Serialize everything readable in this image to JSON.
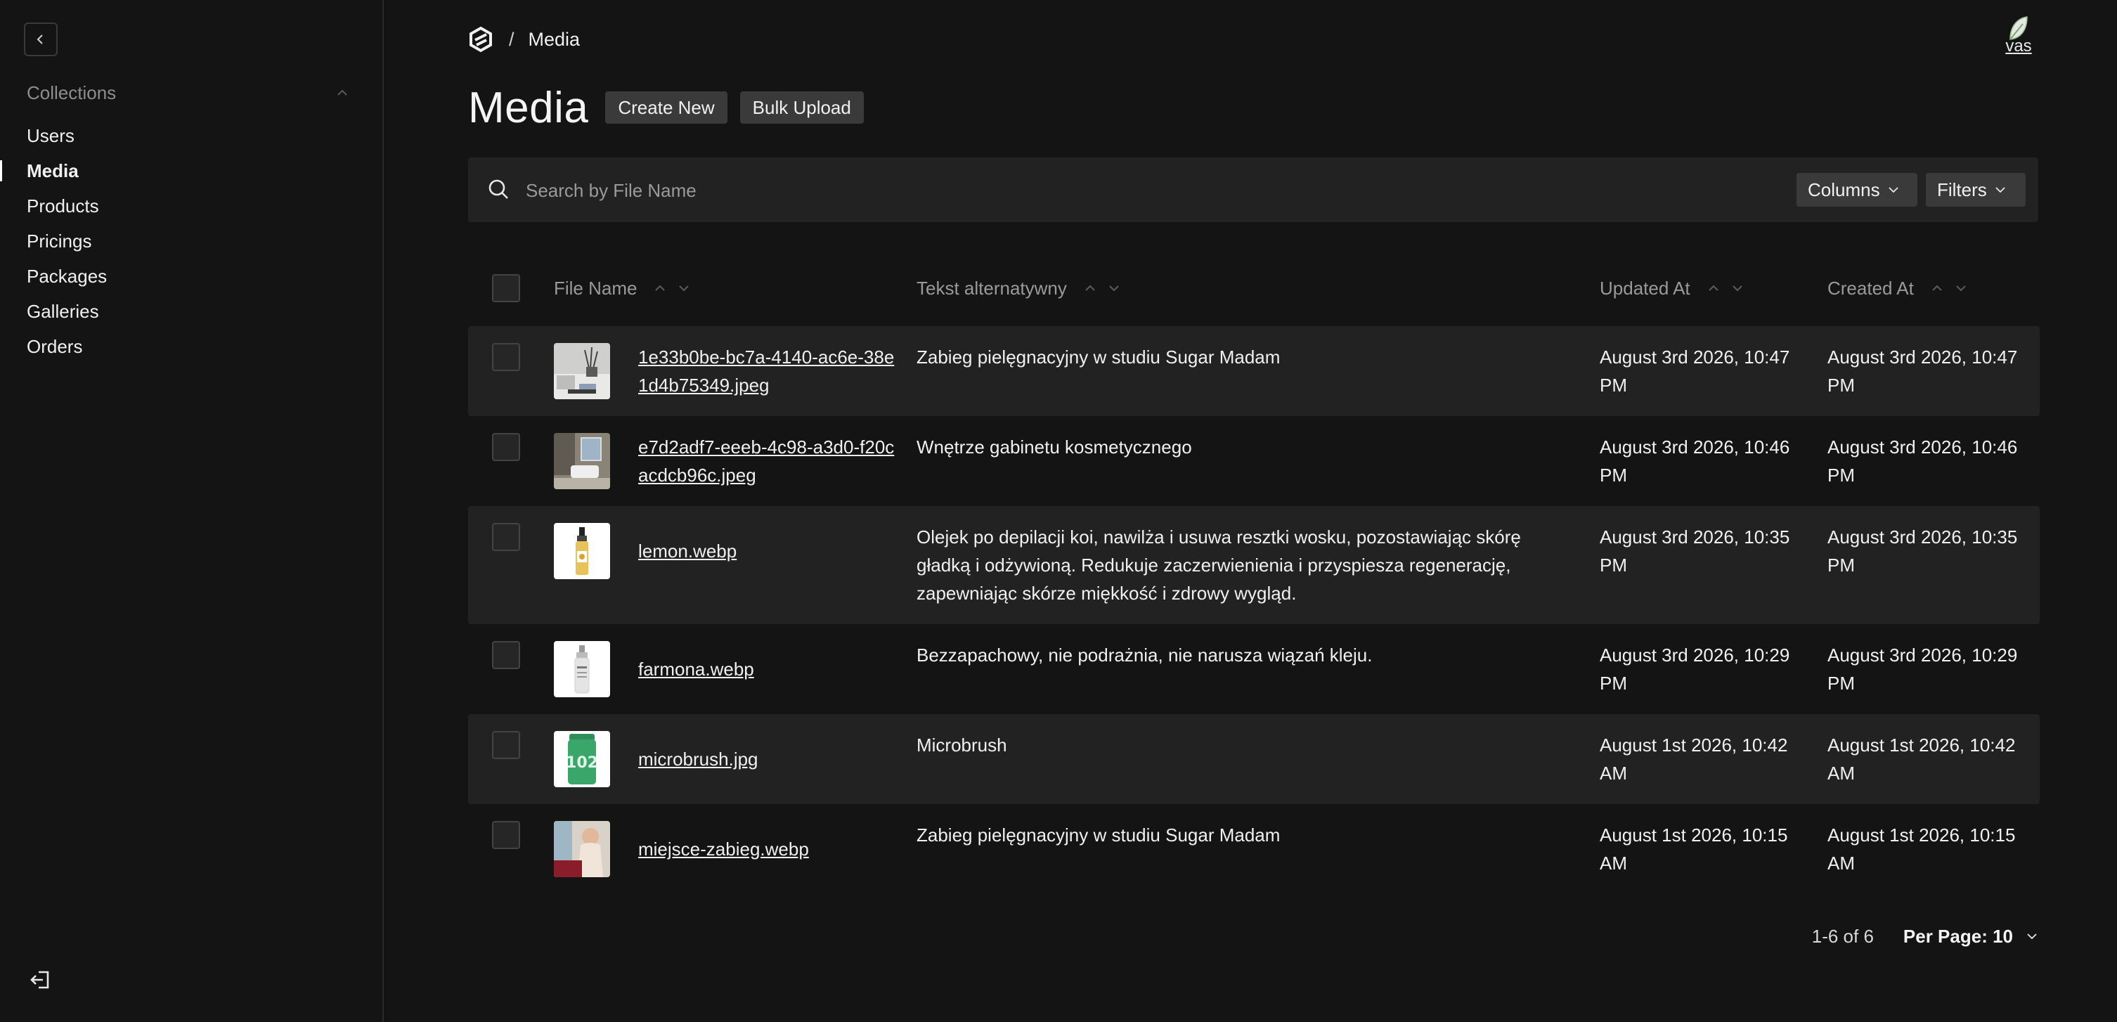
{
  "sidebar": {
    "collections_label": "Collections",
    "items": [
      {
        "label": "Users"
      },
      {
        "label": "Media"
      },
      {
        "label": "Products"
      },
      {
        "label": "Pricings"
      },
      {
        "label": "Packages"
      },
      {
        "label": "Galleries"
      },
      {
        "label": "Orders"
      }
    ],
    "active_item": "Media"
  },
  "header": {
    "breadcrumb_separator": "/",
    "breadcrumb_current": "Media",
    "avatar_alt": "vas",
    "title": "Media",
    "create_new_label": "Create New",
    "bulk_upload_label": "Bulk Upload"
  },
  "search": {
    "placeholder": "Search by File Name",
    "columns_label": "Columns",
    "filters_label": "Filters"
  },
  "table": {
    "columns": {
      "file_name": "File Name",
      "alt_text": "Tekst alternatywny",
      "updated_at": "Updated At",
      "created_at": "Created At"
    },
    "rows": [
      {
        "file_name": "1e33b0be-bc7a-4140-ac6e-38e1d4b75349.jpeg",
        "alt_text": "Zabieg pielęgnacyjny w studiu Sugar Madam",
        "updated_at": "August 3rd 2026, 10:47 PM",
        "created_at": "August 3rd 2026, 10:47 PM",
        "thumb": "salon-interior"
      },
      {
        "file_name": "e7d2adf7-eeeb-4c98-a3d0-f20cacdcb96c.jpeg",
        "alt_text": "Wnętrze gabinetu kosmetycznego",
        "updated_at": "August 3rd 2026, 10:46 PM",
        "created_at": "August 3rd 2026, 10:46 PM",
        "thumb": "cosmetic-room"
      },
      {
        "file_name": "lemon.webp",
        "alt_text": "Olejek po depilacji koi, nawilża i usuwa resztki wosku, pozostawiając skórę gładką i odżywioną. Redukuje zaczerwienienia i przyspiesza regenerację, zapewniając skórze miękkość i zdrowy wygląd.",
        "updated_at": "August 3rd 2026, 10:35 PM",
        "created_at": "August 3rd 2026, 10:35 PM",
        "thumb": "oil-bottle"
      },
      {
        "file_name": "farmona.webp",
        "alt_text": "Bezzapachowy, nie podrażnia, nie narusza wiązań kleju.",
        "updated_at": "August 3rd 2026, 10:29 PM",
        "created_at": "August 3rd 2026, 10:29 PM",
        "thumb": "white-bottle"
      },
      {
        "file_name": "microbrush.jpg",
        "alt_text": "Microbrush",
        "updated_at": "August 1st 2026, 10:42 AM",
        "created_at": "August 1st 2026, 10:42 AM",
        "thumb": "green-container"
      },
      {
        "file_name": "miejsce-zabieg.webp",
        "alt_text": "Zabieg pielęgnacyjny w studiu Sugar Madam",
        "updated_at": "August 1st 2026, 10:15 AM",
        "created_at": "August 1st 2026, 10:15 AM",
        "thumb": "treatment-place"
      }
    ]
  },
  "pagination": {
    "range": "1-6 of 6",
    "per_page": "Per Page: 10"
  },
  "colors": {
    "background": "#141414",
    "row_shade": "#222222",
    "button": "#3a3a3a",
    "text": "#f0f0f0",
    "muted": "#9a9a9a"
  }
}
